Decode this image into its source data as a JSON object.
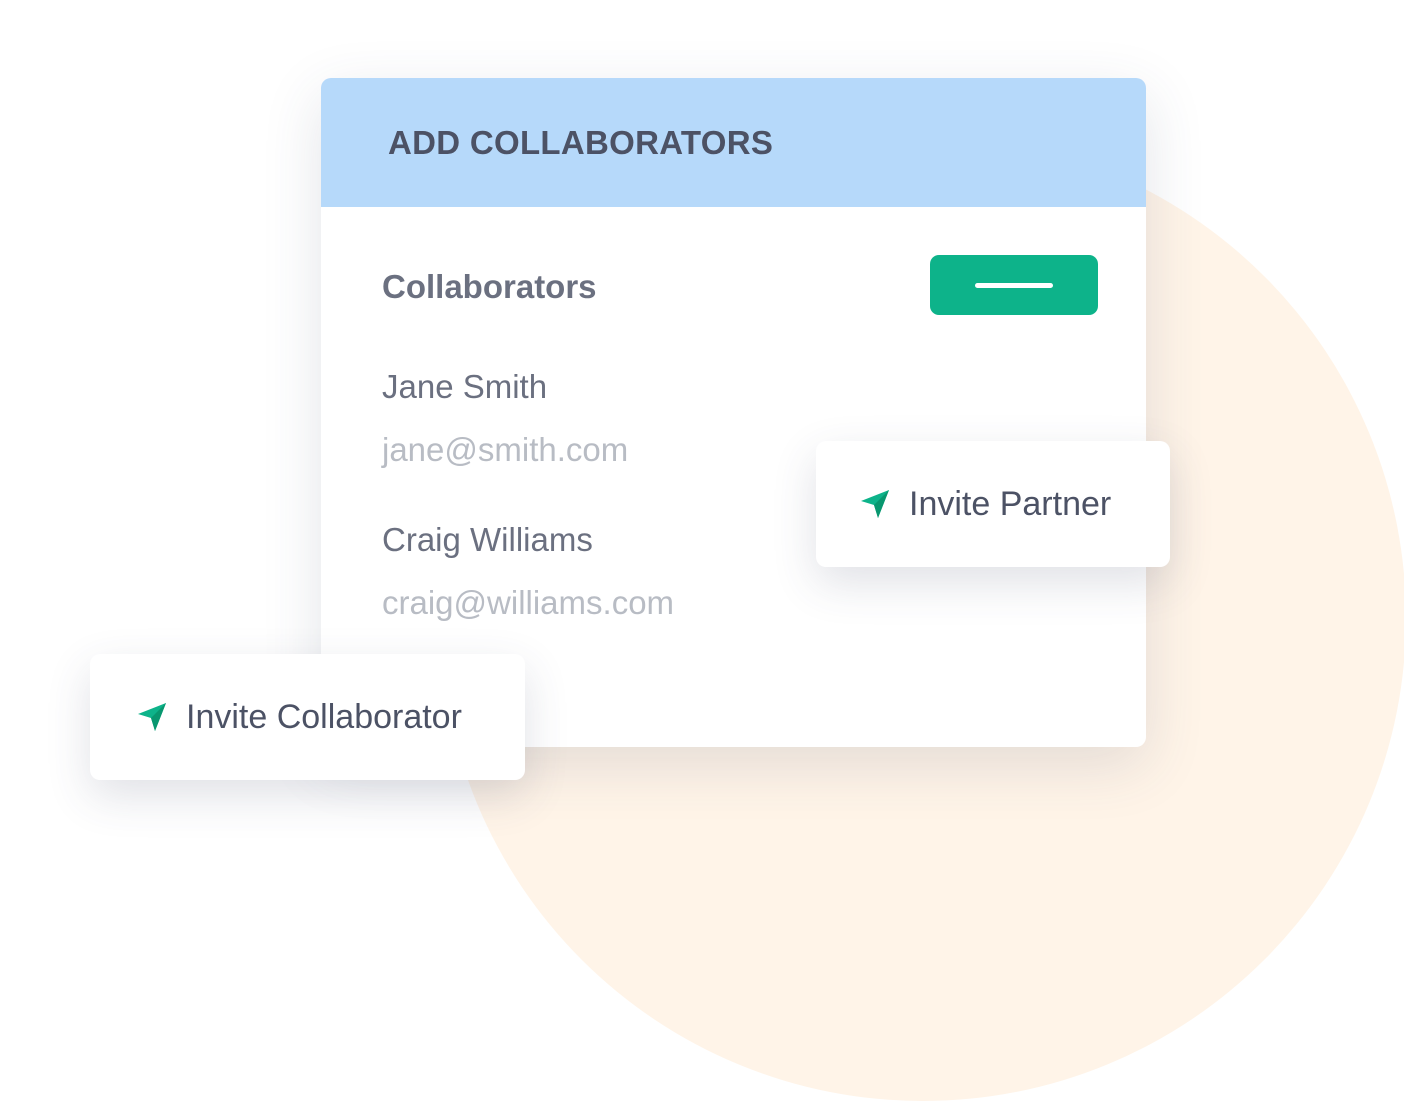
{
  "colors": {
    "background_circle": "#fff4e8",
    "header_bg": "#b6d9fa",
    "accent_green": "#0db38a"
  },
  "panel": {
    "title": "ADD COLLABORATORS",
    "section_label": "Collaborators",
    "add_button_icon": "minus-dash-icon",
    "collaborators": [
      {
        "name": "Jane Smith",
        "email": "jane@smith.com"
      },
      {
        "name": "Craig Williams",
        "email": "craig@williams.com"
      }
    ]
  },
  "actions": {
    "invite_partner": {
      "label": "Invite Partner",
      "icon": "send-icon"
    },
    "invite_collaborator": {
      "label": "Invite Collaborator",
      "icon": "send-icon"
    }
  }
}
